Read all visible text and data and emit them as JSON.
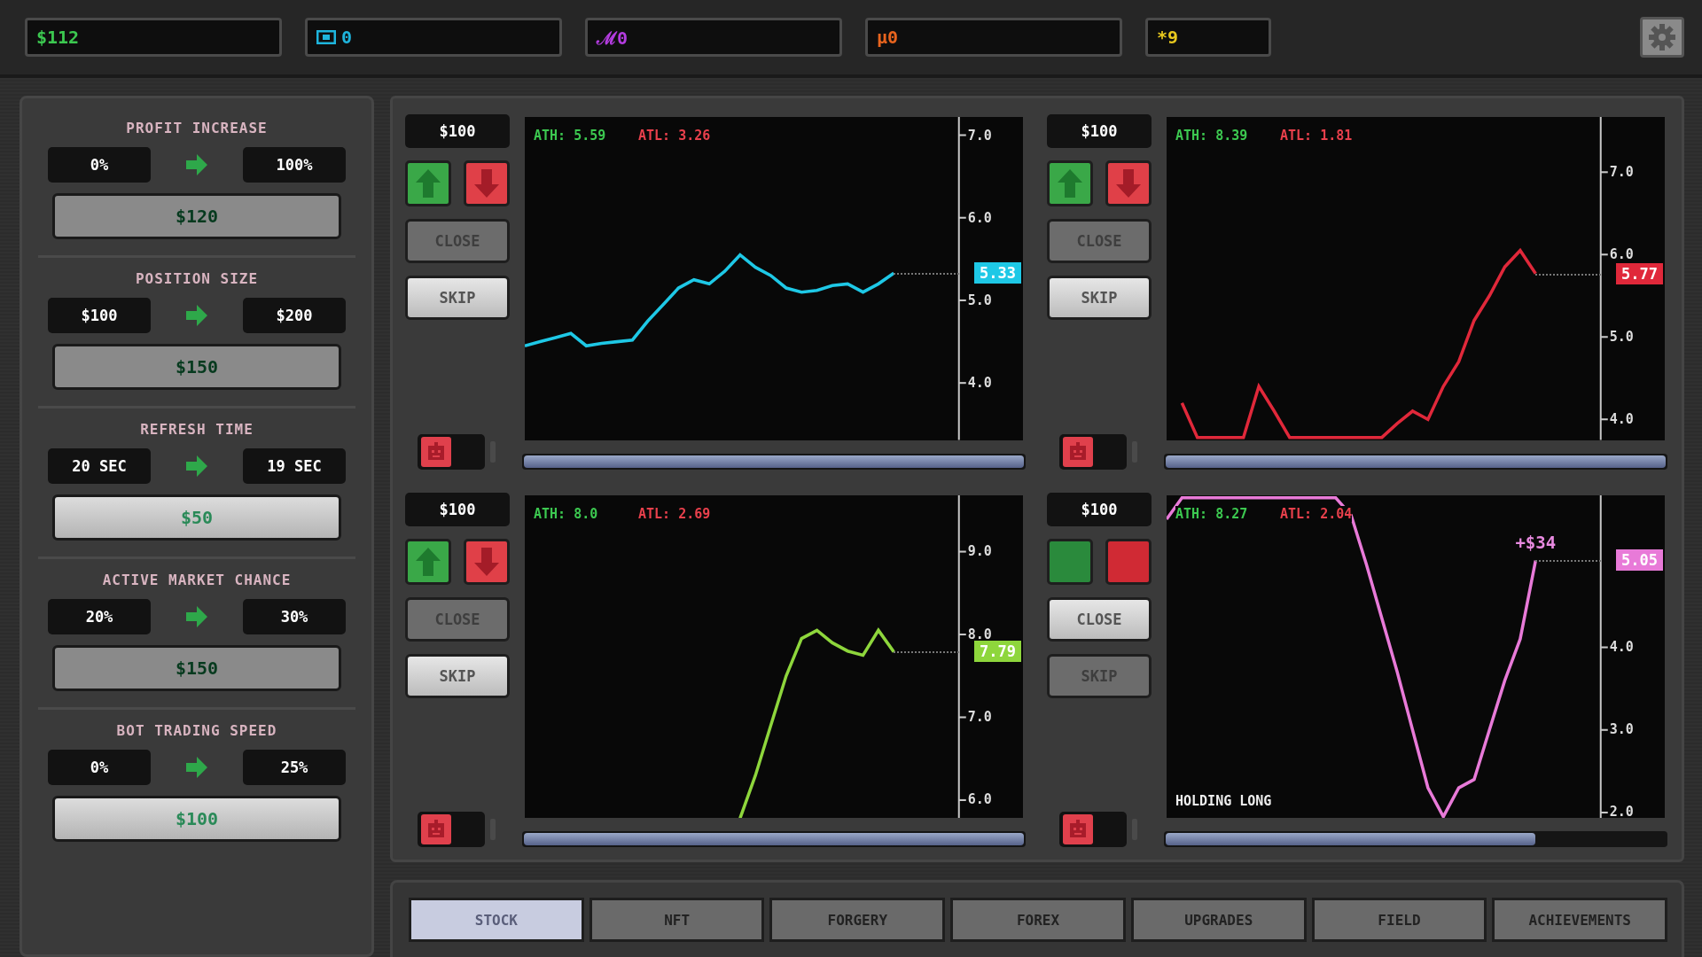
{
  "resources": [
    {
      "text": "$112",
      "color": "#3cc850",
      "kind": "plain"
    },
    {
      "text": "0",
      "color": "#1eb4dc",
      "kind": "chip"
    },
    {
      "text": "ℳ0",
      "color": "#b43ce0",
      "kind": "plain"
    },
    {
      "text": "µ0",
      "color": "#e8641e",
      "kind": "plain"
    },
    {
      "text": "*9",
      "color": "#e8c81e",
      "kind": "plain"
    }
  ],
  "upgrades": [
    {
      "title": "PROFIT INCREASE",
      "from": "0%",
      "to": "100%",
      "cost": "$120",
      "affordable": false
    },
    {
      "title": "POSITION SIZE",
      "from": "$100",
      "to": "$200",
      "cost": "$150",
      "affordable": false
    },
    {
      "title": "REFRESH TIME",
      "from": "20 SEC",
      "to": "19 SEC",
      "cost": "$50",
      "affordable": true
    },
    {
      "title": "ACTIVE MARKET CHANCE",
      "from": "20%",
      "to": "30%",
      "cost": "$150",
      "affordable": false
    },
    {
      "title": "BOT TRADING SPEED",
      "from": "0%",
      "to": "25%",
      "cost": "$100",
      "affordable": true
    }
  ],
  "panels": [
    {
      "position": "$100",
      "show_arrows": true,
      "close_enabled": false,
      "close": "CLOSE",
      "skip_enabled": true,
      "skip": "SKIP",
      "bot_on": false,
      "progress": {
        "level": 1
      },
      "ath": "ATH: 5.59",
      "atl": "ATL: 3.26",
      "price_label": "5.33",
      "chart_data": {
        "type": "line",
        "categories": [
          null,
          null,
          null,
          null,
          null,
          null,
          null,
          null,
          null,
          null,
          null,
          null,
          null,
          null,
          null,
          null,
          null,
          null,
          null,
          null,
          null,
          null,
          null,
          null,
          null
        ],
        "ylim": [
          3.31,
          7.22
        ],
        "yticks": [
          {
            "value": 4,
            "label": "4.0"
          },
          {
            "value": 5,
            "label": "5.0"
          },
          {
            "value": 6,
            "label": "6.0"
          },
          {
            "value": 7,
            "label": "7.0"
          }
        ],
        "series": [
          {
            "color": "#1ec8e6",
            "values": [
              4.45,
              4.5,
              4.55,
              4.6,
              4.45,
              4.48,
              4.5,
              4.52,
              4.75,
              4.95,
              5.15,
              5.25,
              5.2,
              5.35,
              5.55,
              5.4,
              5.3,
              5.15,
              5.1,
              5.12,
              5.18,
              5.2,
              5.1,
              5.2,
              5.33
            ]
          }
        ]
      }
    },
    {
      "position": "$100",
      "show_arrows": true,
      "close_enabled": false,
      "close": "CLOSE",
      "skip_enabled": true,
      "skip": "SKIP",
      "bot_on": false,
      "progress": {
        "level": 1
      },
      "ath": "ATH: 8.39",
      "atl": "ATL: 1.81",
      "price_label": "5.77",
      "chart_data": {
        "type": "line",
        "categories": [
          null,
          null,
          null,
          null,
          null,
          null,
          null,
          null,
          null,
          null,
          null,
          null,
          null,
          null,
          null,
          null,
          null,
          null,
          null,
          null,
          null,
          null,
          null,
          null
        ],
        "ylim": [
          3.75,
          7.67
        ],
        "yticks": [
          {
            "value": 4,
            "label": "4.0"
          },
          {
            "value": 5,
            "label": "5.0"
          },
          {
            "value": 6,
            "label": "6.0"
          },
          {
            "value": 7,
            "label": "7.0"
          }
        ],
        "series": [
          {
            "color": "#e0283a",
            "values": [
              4.2,
              3.78,
              3.78,
              3.78,
              3.78,
              4.4,
              4.1,
              3.78,
              3.78,
              3.78,
              3.78,
              3.78,
              3.78,
              3.78,
              3.95,
              4.1,
              4.0,
              4.4,
              4.7,
              5.2,
              5.5,
              5.85,
              6.05,
              5.77
            ]
          }
        ]
      }
    },
    {
      "position": "$100",
      "show_arrows": true,
      "close_enabled": false,
      "close": "CLOSE",
      "skip_enabled": true,
      "skip": "SKIP",
      "bot_on": false,
      "progress": {
        "level": 1
      },
      "ath": "ATH: 8.0",
      "atl": "ATL: 2.69",
      "price_label": "7.79",
      "chart_data": {
        "type": "line",
        "categories": [
          null,
          null,
          null,
          null,
          null,
          null,
          null,
          null,
          null,
          null,
          null
        ],
        "ylim": [
          5.78,
          9.68
        ],
        "yticks": [
          {
            "value": 6,
            "label": "6.0"
          },
          {
            "value": 7,
            "label": "7.0"
          },
          {
            "value": 8,
            "label": "8.0"
          },
          {
            "value": 9,
            "label": "9.0"
          }
        ],
        "series": [
          {
            "color": "#8ed63c",
            "values": [
              5.78,
              6.3,
              6.9,
              7.5,
              7.95,
              8.05,
              7.9,
              7.8,
              7.75,
              8.05,
              7.79
            ]
          }
        ]
      }
    },
    {
      "position": "$100",
      "show_arrows": false,
      "close_enabled": true,
      "close": "CLOSE",
      "skip_enabled": false,
      "skip": "SKIP",
      "bot_on": false,
      "progress": {
        "level": 0.74
      },
      "ath": "ATH: 8.27",
      "atl": "ATL: 2.04",
      "price_label": "5.05",
      "profit": "+$34",
      "status": "HOLDING LONG",
      "chart_data": {
        "type": "line",
        "categories": [
          null,
          null,
          null,
          null,
          null,
          null,
          null,
          null,
          null,
          null,
          null,
          null,
          null,
          null,
          null,
          null,
          null,
          null,
          null,
          null,
          null,
          null,
          null,
          null,
          null
        ],
        "ylim": [
          1.93,
          5.84
        ],
        "yticks": [
          {
            "value": 2,
            "label": "2.0"
          },
          {
            "value": 3,
            "label": "3.0"
          },
          {
            "value": 4,
            "label": "4.0"
          }
        ],
        "series": [
          {
            "color": "#e87ad8",
            "values": [
              5.55,
              5.81,
              5.81,
              5.81,
              5.81,
              5.81,
              5.81,
              5.81,
              5.81,
              5.81,
              5.81,
              5.81,
              5.6,
              5.0,
              4.35,
              3.7,
              3.0,
              2.3,
              1.95,
              2.3,
              2.4,
              3.0,
              3.6,
              4.1,
              5.05
            ]
          }
        ]
      }
    }
  ],
  "tabs": [
    {
      "label": "STOCK",
      "selected": true
    },
    {
      "label": "NFT",
      "selected": false
    },
    {
      "label": "FORGERY",
      "selected": false
    },
    {
      "label": "FOREX",
      "selected": false
    },
    {
      "label": "UPGRADES",
      "selected": false
    },
    {
      "label": "FIELD",
      "selected": false
    },
    {
      "label": "ACHIEVEMENTS",
      "selected": false
    }
  ]
}
